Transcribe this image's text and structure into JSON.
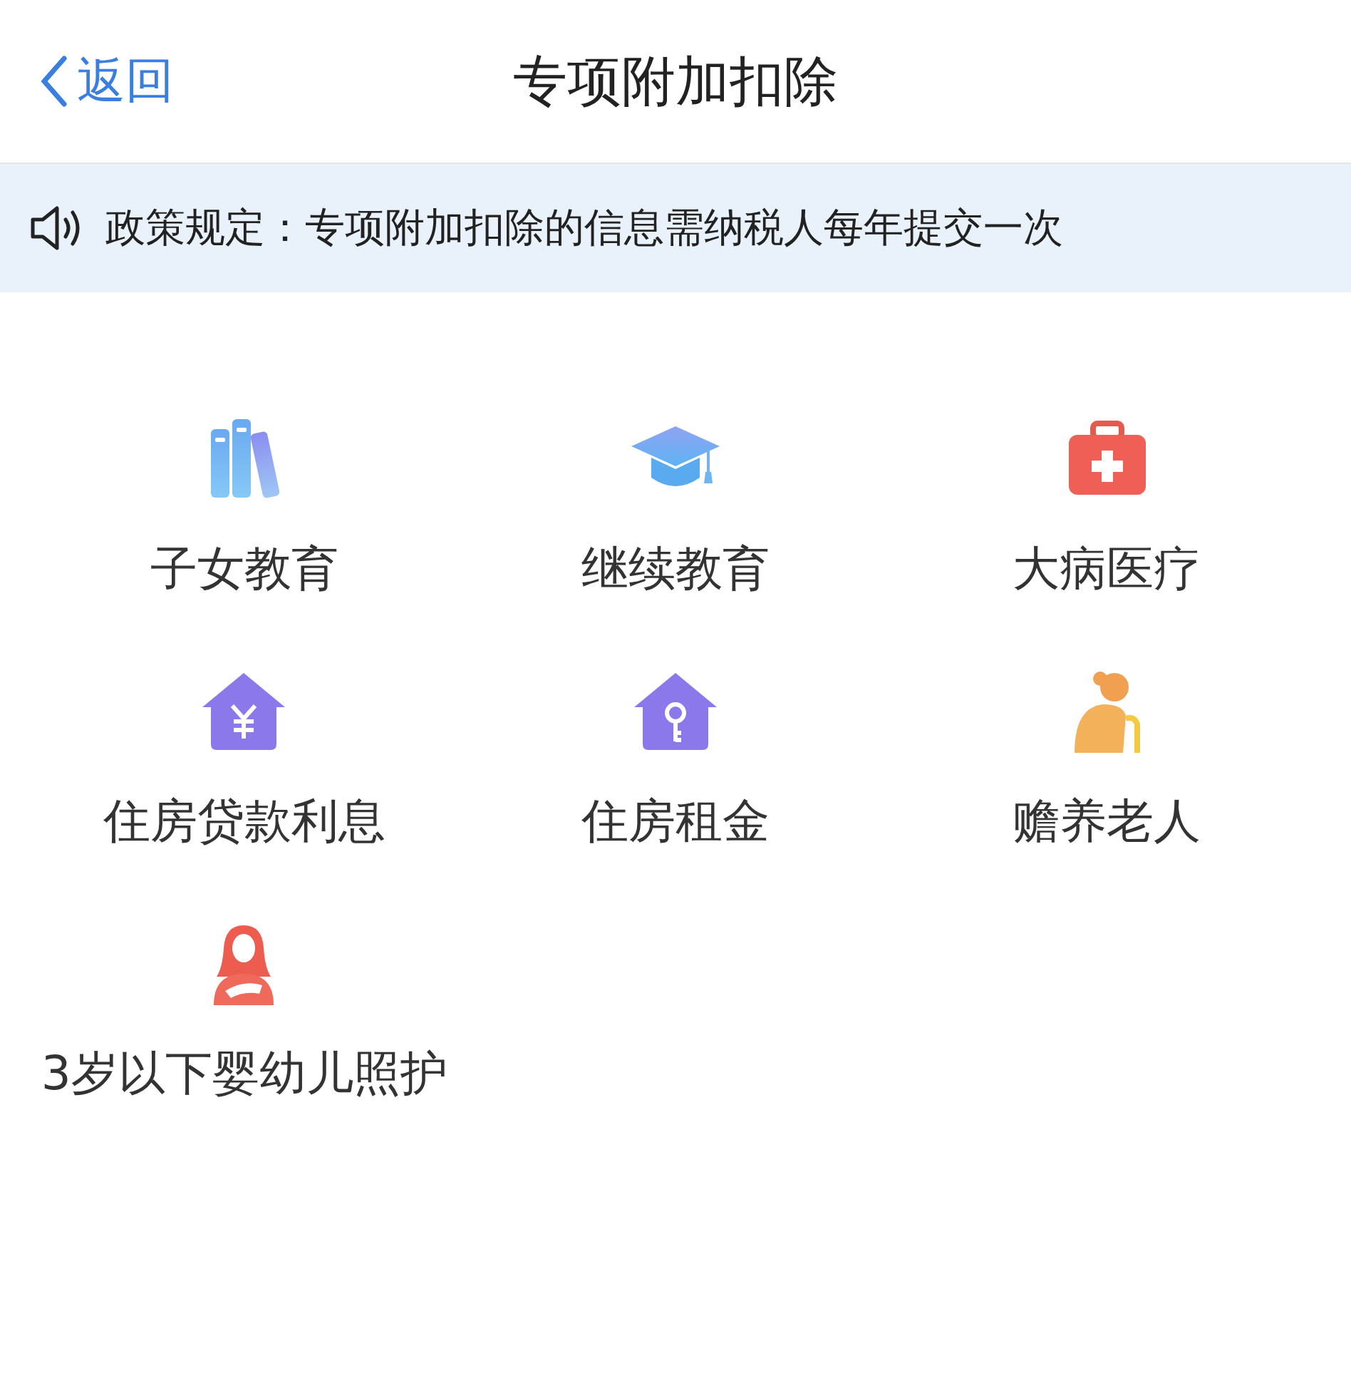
{
  "header": {
    "back_label": "返回",
    "title": "专项附加扣除"
  },
  "notice": {
    "text": "政策规定：专项附加扣除的信息需纳税人每年提交一次"
  },
  "items": [
    {
      "label": "子女教育",
      "kind": "books"
    },
    {
      "label": "继续教育",
      "kind": "cap"
    },
    {
      "label": "大病医疗",
      "kind": "medkit"
    },
    {
      "label": "住房贷款利息",
      "kind": "house-yen"
    },
    {
      "label": "住房租金",
      "kind": "house-key"
    },
    {
      "label": "赡养老人",
      "kind": "elder"
    },
    {
      "label": "3岁以下婴幼儿照护",
      "kind": "mother"
    }
  ]
}
